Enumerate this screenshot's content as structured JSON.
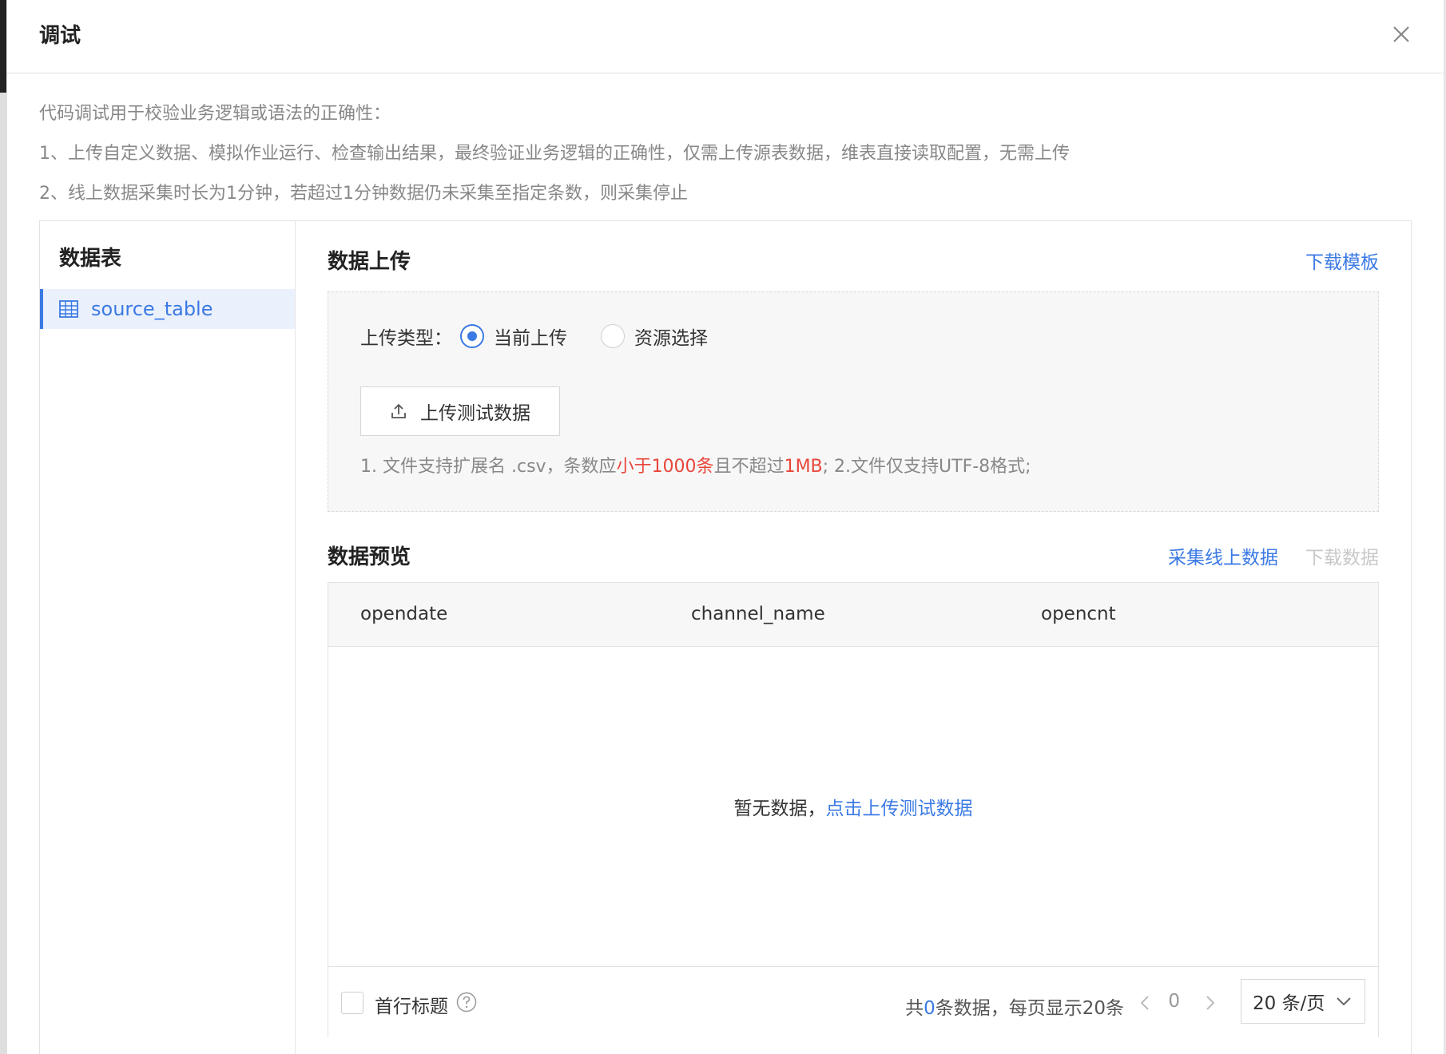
{
  "dialog": {
    "title": "调试"
  },
  "description": [
    "代码调试用于校验业务逻辑或语法的正确性：",
    "1、上传自定义数据、模拟作业运行、检查输出结果，最终验证业务逻辑的正确性，仅需上传源表数据，维表直接读取配置，无需上传",
    "2、线上数据采集时长为1分钟，若超过1分钟数据仍未采集至指定条数，则采集停止"
  ],
  "sidebar": {
    "title": "数据表",
    "items": [
      {
        "label": "source_table",
        "icon": "table-icon",
        "selected": true
      }
    ]
  },
  "upload": {
    "title": "数据上传",
    "download_template": "下载模板",
    "type_label": "上传类型：",
    "options": [
      {
        "label": "当前上传",
        "checked": true
      },
      {
        "label": "资源选择",
        "checked": false
      }
    ],
    "button_label": "上传测试数据",
    "hint_part1": "1. 文件支持扩展名 .csv，条数应",
    "hint_red1": "小于1000条",
    "hint_part2": "且不超过",
    "hint_red2": "1MB",
    "hint_part3": "; 2.文件仅支持UTF-8格式;"
  },
  "preview": {
    "title": "数据预览",
    "collect_link": "采集线上数据",
    "download_link": "下载数据",
    "columns": [
      "opendate",
      "channel_name",
      "opencnt"
    ],
    "empty_text": "暂无数据，",
    "empty_link": "点击上传测试数据",
    "first_row_header": "首行标题",
    "total_prefix": "共",
    "total_count": "0",
    "total_suffix": "条数据，每页显示20条",
    "current_page": "0",
    "page_size": "20 条/页"
  },
  "colors": {
    "accent": "#3b7ae4",
    "warning": "#e8463a"
  }
}
